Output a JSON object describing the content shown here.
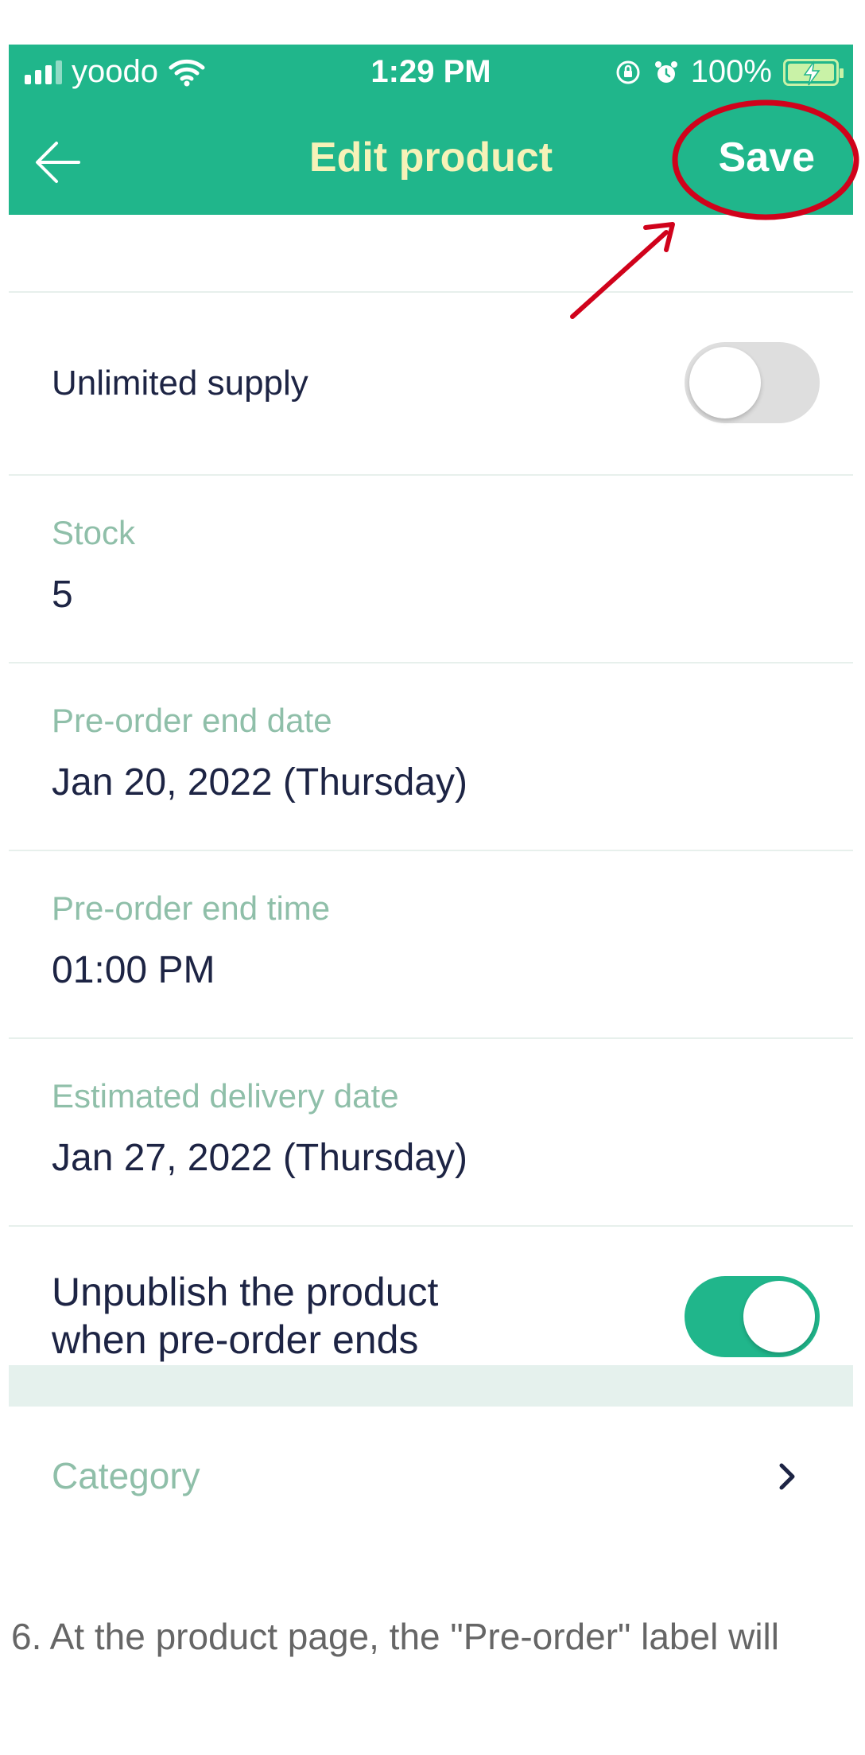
{
  "status_bar": {
    "carrier": "yoodo",
    "time": "1:29 PM",
    "battery": "100%"
  },
  "nav": {
    "title": "Edit product",
    "save_label": "Save"
  },
  "rows": {
    "unlimited_supply": {
      "label": "Unlimited supply",
      "enabled": false
    },
    "stock": {
      "label": "Stock",
      "value": "5"
    },
    "preorder_end_date": {
      "label": "Pre-order end date",
      "value": "Jan 20, 2022 (Thursday)"
    },
    "preorder_end_time": {
      "label": "Pre-order end time",
      "value": "01:00 PM"
    },
    "estimated_delivery": {
      "label": "Estimated delivery date",
      "value": "Jan 27, 2022 (Thursday)"
    },
    "unpublish": {
      "line1": "Unpublish the product",
      "line2": "when pre-order ends",
      "enabled": true
    },
    "category": {
      "label": "Category"
    }
  },
  "caption": "6. At the product page, the \"Pre-order\" label will",
  "colors": {
    "accent": "#20b68b",
    "annotation": "#d0021b",
    "label": "#8fbfa9",
    "value": "#1d2444"
  }
}
